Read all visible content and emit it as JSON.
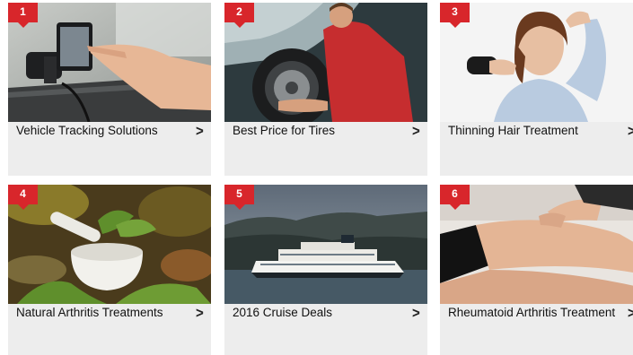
{
  "cards": [
    {
      "number": "1",
      "title": "Vehicle Tracking Solutions",
      "chevron": ">",
      "image_icon": "gps-device-photo"
    },
    {
      "number": "2",
      "title": "Best Price for Tires",
      "chevron": ">",
      "image_icon": "tire-mechanic-photo"
    },
    {
      "number": "3",
      "title": "Thinning Hair Treatment",
      "chevron": ">",
      "image_icon": "woman-hair-photo"
    },
    {
      "number": "4",
      "title": "Natural Arthritis Treatments",
      "chevron": ">",
      "image_icon": "herbs-mortar-photo"
    },
    {
      "number": "5",
      "title": "2016 Cruise Deals",
      "chevron": ">",
      "image_icon": "cruise-ship-photo"
    },
    {
      "number": "6",
      "title": "Rheumatoid Arthritis Treatment",
      "chevron": ">",
      "image_icon": "knee-massage-photo"
    }
  ],
  "colors": {
    "badge": "#d8262b",
    "card_bg": "#ededed",
    "text": "#111111"
  }
}
